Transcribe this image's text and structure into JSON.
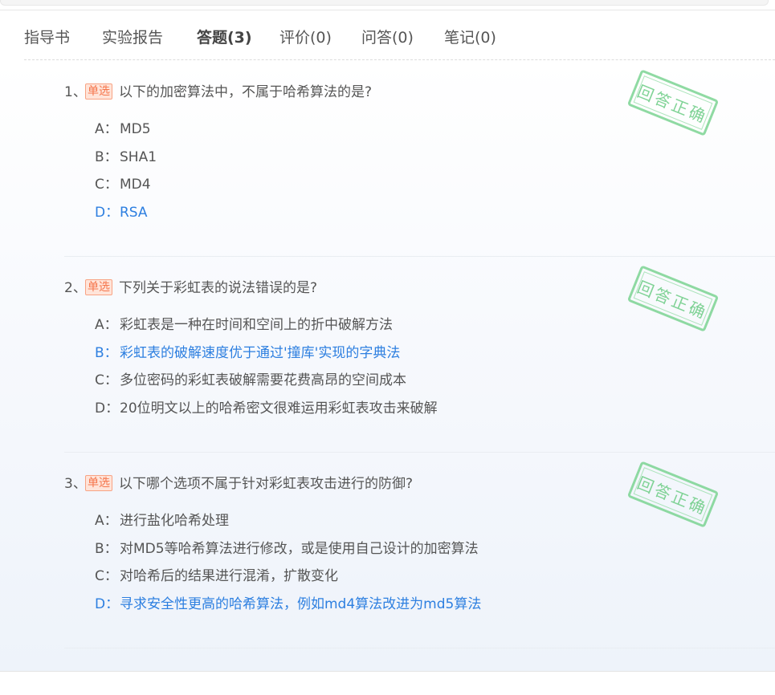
{
  "tabs": [
    {
      "label": "指导书"
    },
    {
      "label": "实验报告"
    },
    {
      "label": "答题(3)",
      "active": true
    },
    {
      "label": "评价(0)"
    },
    {
      "label": "问答(0)"
    },
    {
      "label": "笔记(0)"
    }
  ],
  "questions": [
    {
      "number": "1、",
      "type": "单选",
      "text": "以下的加密算法中，不属于哈希算法的是?",
      "stamp": "回答正确",
      "options": [
        {
          "letter": "A：",
          "text": "MD5"
        },
        {
          "letter": "B：",
          "text": "SHA1"
        },
        {
          "letter": "C：",
          "text": "MD4"
        },
        {
          "letter": "D：",
          "text": "RSA",
          "correct": true
        }
      ]
    },
    {
      "number": "2、",
      "type": "单选",
      "text": "下列关于彩虹表的说法错误的是?",
      "stamp": "回答正确",
      "options": [
        {
          "letter": "A：",
          "text": "彩虹表是一种在时间和空间上的折中破解方法"
        },
        {
          "letter": "B：",
          "text": "彩虹表的破解速度优于通过'撞库'实现的字典法",
          "correct": true
        },
        {
          "letter": "C：",
          "text": "多位密码的彩虹表破解需要花费高昂的空间成本"
        },
        {
          "letter": "D：",
          "text": "20位明文以上的哈希密文很难运用彩虹表攻击来破解"
        }
      ]
    },
    {
      "number": "3、",
      "type": "单选",
      "text": "以下哪个选项不属于针对彩虹表攻击进行的防御?",
      "stamp": "回答正确",
      "options": [
        {
          "letter": "A：",
          "text": "进行盐化哈希处理"
        },
        {
          "letter": "B：",
          "text": "对MD5等哈希算法进行修改，或是使用自己设计的加密算法"
        },
        {
          "letter": "C：",
          "text": "对哈希后的结果进行混淆，扩散变化"
        },
        {
          "letter": "D：",
          "text": "寻求安全性更高的哈希算法，例如md4算法改进为md5算法",
          "correct": true
        }
      ]
    }
  ],
  "colors": {
    "correct_option": "#2d7fe0",
    "badge": "#f5754b",
    "stamp": "#6bcc84"
  }
}
